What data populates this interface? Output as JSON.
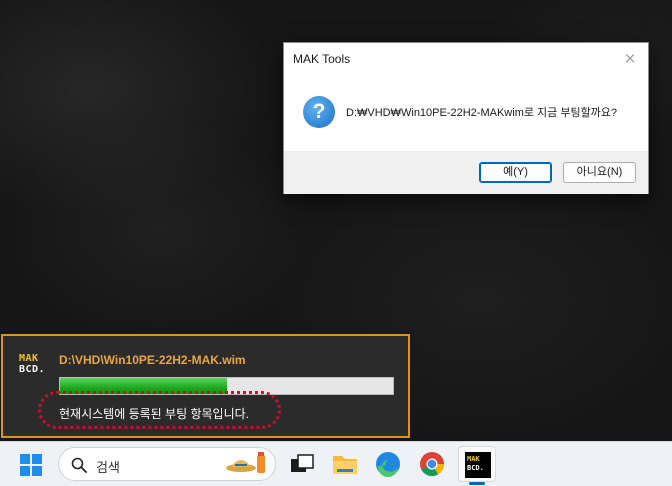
{
  "dialog": {
    "title": "MAK Tools",
    "close_glyph": "×",
    "message": "D:₩VHD₩Win10PE-22H2-MAKwim로 지금 부팅할까요?",
    "icon": "question-icon",
    "yes_label": "예(Y)",
    "no_label": "아니요(N)"
  },
  "progress_panel": {
    "logo_line1": "MAK",
    "logo_line2": "BCD.",
    "file_path": "D:\\VHD\\Win10PE-22H2-MAK.wim",
    "progress_fraction": 0.5,
    "status": "현재시스템에 등록된 부팅 항목입니다.",
    "accent_color": "#e0901c",
    "highlight_color": "#c8102e"
  },
  "taskbar": {
    "search_placeholder": "검색",
    "apps": [
      "task-view-icon",
      "file-explorer-icon",
      "edge-icon",
      "chrome-icon",
      "mak-bcd-icon"
    ],
    "mak_logo_line1": "MAK",
    "mak_logo_line2": "BCD."
  }
}
